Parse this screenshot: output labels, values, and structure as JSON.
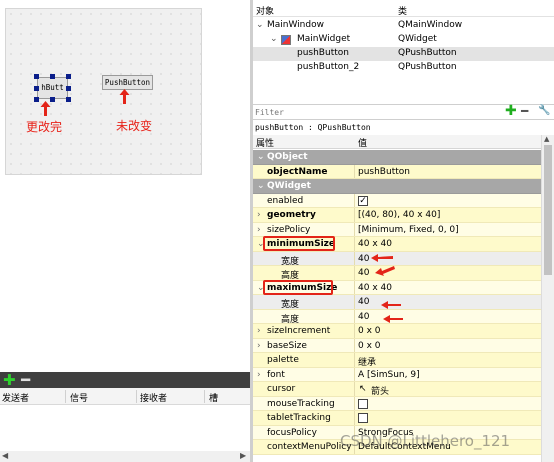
{
  "canvas": {
    "buttons": {
      "changed_text": "hButt",
      "unchanged_text": "PushButton"
    },
    "annotations": {
      "changed": "更改完",
      "unchanged": "未改变"
    }
  },
  "signal_editor": {
    "columns": [
      "发送者",
      "信号",
      "接收者",
      "槽"
    ]
  },
  "object_inspector": {
    "headers": {
      "object": "对象",
      "class": "类"
    },
    "rows": [
      {
        "object": "MainWindow",
        "class": "QMainWindow"
      },
      {
        "object": "MainWidget",
        "class": "QWidget"
      },
      {
        "object": "pushButton",
        "class": "QPushButton"
      },
      {
        "object": "pushButton_2",
        "class": "QPushButton"
      }
    ]
  },
  "property_editor": {
    "filter_placeholder": "Filter",
    "object_label": "pushButton : QPushButton",
    "headers": {
      "property": "属性",
      "value": "值"
    },
    "rows": [
      {
        "name": "QObject",
        "value": ""
      },
      {
        "name": "objectName",
        "value": "pushButton"
      },
      {
        "name": "QWidget",
        "value": ""
      },
      {
        "name": "enabled",
        "value": "✓"
      },
      {
        "name": "geometry",
        "value": "[(40, 80), 40 x 40]"
      },
      {
        "name": "sizePolicy",
        "value": "[Minimum, Fixed, 0, 0]"
      },
      {
        "name": "minimumSize",
        "value": "40 x 40"
      },
      {
        "name": "宽度",
        "value": "40"
      },
      {
        "name": "高度",
        "value": "40"
      },
      {
        "name": "maximumSize",
        "value": "40 x 40"
      },
      {
        "name": "宽度",
        "value": "40"
      },
      {
        "name": "高度",
        "value": "40"
      },
      {
        "name": "sizeIncrement",
        "value": "0 x 0"
      },
      {
        "name": "baseSize",
        "value": "0 x 0"
      },
      {
        "name": "palette",
        "value": "继承"
      },
      {
        "name": "font",
        "value": "A  [SimSun, 9]"
      },
      {
        "name": "cursor",
        "value": "箭头"
      },
      {
        "name": "mouseTracking",
        "value": ""
      },
      {
        "name": "tabletTracking",
        "value": ""
      },
      {
        "name": "focusPolicy",
        "value": "StrongFocus"
      },
      {
        "name": "contextMenuPolicy",
        "value": "DefaultContextMenu"
      }
    ]
  },
  "watermark": "CSDN @Littlehero_121",
  "colors": {
    "annotation_red": "#e32418",
    "property_row": "#fefacb",
    "group_row": "#a7a7a7",
    "add_green": "#1fae1f"
  }
}
